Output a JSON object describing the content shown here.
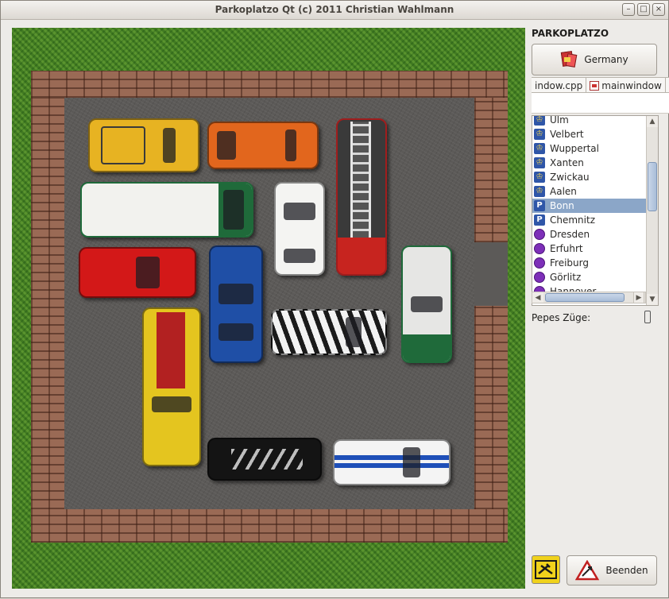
{
  "window": {
    "title": "Parkoplatzo Qt (c) 2011 Christian Wahlmann",
    "controls": {
      "minimize": "–",
      "maximize": "□",
      "close": "×"
    }
  },
  "sidebar": {
    "title": "PARKOPLATZO",
    "country_button": "Germany",
    "tabs": [
      "indow.cpp",
      "mainwindow"
    ],
    "levels": [
      {
        "name": "Ulm",
        "icon": "trophy-icon"
      },
      {
        "name": "Velbert",
        "icon": "trophy-icon"
      },
      {
        "name": "Wuppertal",
        "icon": "trophy-icon"
      },
      {
        "name": "Xanten",
        "icon": "trophy-icon"
      },
      {
        "name": "Zwickau",
        "icon": "trophy-icon"
      },
      {
        "name": "Aalen",
        "icon": "trophy-icon"
      },
      {
        "name": "Bonn",
        "icon": "parking-icon",
        "selected": true
      },
      {
        "name": "Chemnitz",
        "icon": "parking-icon"
      },
      {
        "name": "Dresden",
        "icon": "purple-dot-icon"
      },
      {
        "name": "Erfuhrt",
        "icon": "purple-dot-icon"
      },
      {
        "name": "Freiburg",
        "icon": "purple-dot-icon"
      },
      {
        "name": "Görlitz",
        "icon": "purple-dot-icon"
      },
      {
        "name": "Hannover",
        "icon": "purple-dot-icon"
      }
    ],
    "moves_label": "Pepes Züge:",
    "moves_value": "",
    "quit_button": "Beenden"
  },
  "colors": {
    "accent_selected": "#8ba6c8",
    "grass": "#4c8a2a",
    "brick": "#9a6a55",
    "asphalt": "#5c5a58"
  }
}
